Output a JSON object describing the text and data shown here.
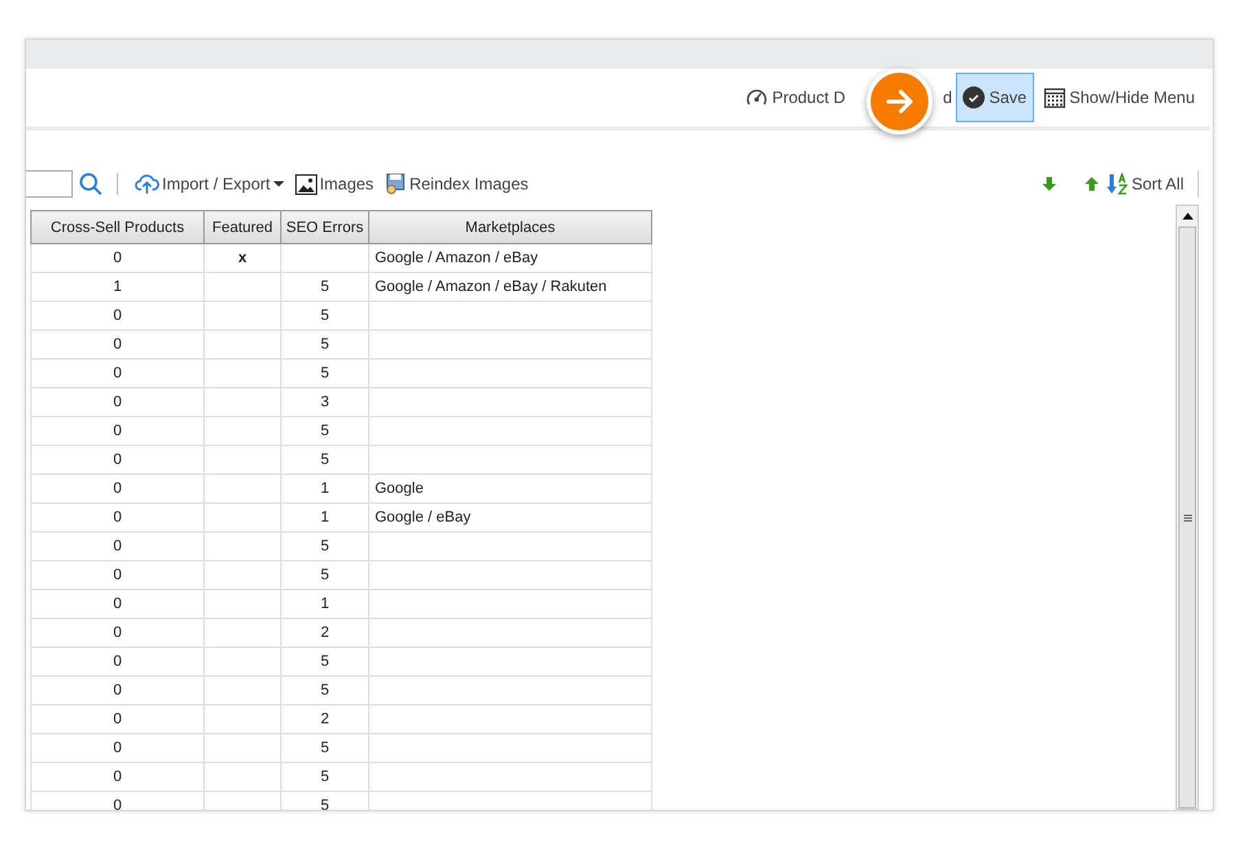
{
  "top_toolbar": {
    "product_button": {
      "label": "Product D",
      "label_tail": "d"
    },
    "save_button": {
      "label": "Save",
      "selected": true
    },
    "menu_button": {
      "label": "Show/Hide Menu"
    }
  },
  "grid_toolbar": {
    "import_export": "Import / Export",
    "images": "Images",
    "reindex": "Reindex Images",
    "sort_all": "Sort All"
  },
  "table": {
    "columns": [
      "Cross-Sell Products",
      "Featured",
      "SEO Errors",
      "Marketplaces"
    ],
    "rows": [
      {
        "cross_sell": "0",
        "featured": "x",
        "marketplaces": "Google / Amazon / eBay"
      },
      {
        "cross_sell": "1",
        "seo_errors": "5",
        "marketplaces": "Google / Amazon / eBay / Rakuten"
      },
      {
        "cross_sell": "0",
        "seo_errors": "5"
      },
      {
        "cross_sell": "0",
        "seo_errors": "5"
      },
      {
        "cross_sell": "0",
        "seo_errors": "5"
      },
      {
        "cross_sell": "0",
        "seo_errors": "3"
      },
      {
        "cross_sell": "0",
        "seo_errors": "5"
      },
      {
        "cross_sell": "0",
        "seo_errors": "5"
      },
      {
        "cross_sell": "0",
        "seo_errors": "1",
        "marketplaces": "Google"
      },
      {
        "cross_sell": "0",
        "seo_errors": "1",
        "marketplaces": "Google / eBay"
      },
      {
        "cross_sell": "0",
        "seo_errors": "5"
      },
      {
        "cross_sell": "0",
        "seo_errors": "5"
      },
      {
        "cross_sell": "0",
        "seo_errors": "1"
      },
      {
        "cross_sell": "0",
        "seo_errors": "2"
      },
      {
        "cross_sell": "0",
        "seo_errors": "5"
      },
      {
        "cross_sell": "0",
        "seo_errors": "5"
      },
      {
        "cross_sell": "0",
        "seo_errors": "2"
      },
      {
        "cross_sell": "0",
        "seo_errors": "5"
      },
      {
        "cross_sell": "0",
        "seo_errors": "5"
      },
      {
        "cross_sell": "0",
        "seo_errors": "5"
      }
    ]
  }
}
